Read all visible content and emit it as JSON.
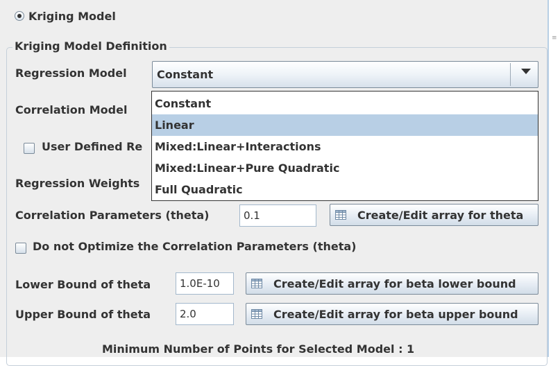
{
  "kriging_model_radio": {
    "label": "Kriging Model",
    "selected": true
  },
  "definition_group": {
    "title": "Kriging Model Definition"
  },
  "regression_model": {
    "label": "Regression Model",
    "selected_value": "Constant",
    "options": [
      "Constant",
      "Linear",
      "Mixed:Linear+Interactions",
      "Mixed:Linear+Pure Quadratic",
      "Full Quadratic"
    ],
    "highlighted_option": "Linear"
  },
  "correlation_model": {
    "label": "Correlation Model"
  },
  "user_defined_checkbox": {
    "label": "User Defined Re",
    "checked": false
  },
  "regression_weights": {
    "label": "Regression Weights"
  },
  "correlation_parameters": {
    "label": "Correlation Parameters (theta)",
    "value": "0.1",
    "button_label": "Create/Edit array for theta"
  },
  "do_not_optimize_checkbox": {
    "label": "Do not Optimize the Correlation Parameters (theta)",
    "checked": false
  },
  "lower_bound": {
    "label": "Lower Bound of theta",
    "value": "1.0E-10",
    "button_label": "Create/Edit array for beta lower bound"
  },
  "upper_bound": {
    "label": "Upper Bound of theta",
    "value": "2.0",
    "button_label": "Create/Edit array for beta upper bound"
  },
  "footer": {
    "min_points_text": "Minimum Number of Points for Selected Model : 1"
  },
  "colors": {
    "panel_bg": "#eeeeee",
    "selection": "#b8cfe5",
    "border": "#7a8a99"
  },
  "icons": {
    "button_icon": "table-icon",
    "dropdown_icon": "chevron-down-icon"
  }
}
